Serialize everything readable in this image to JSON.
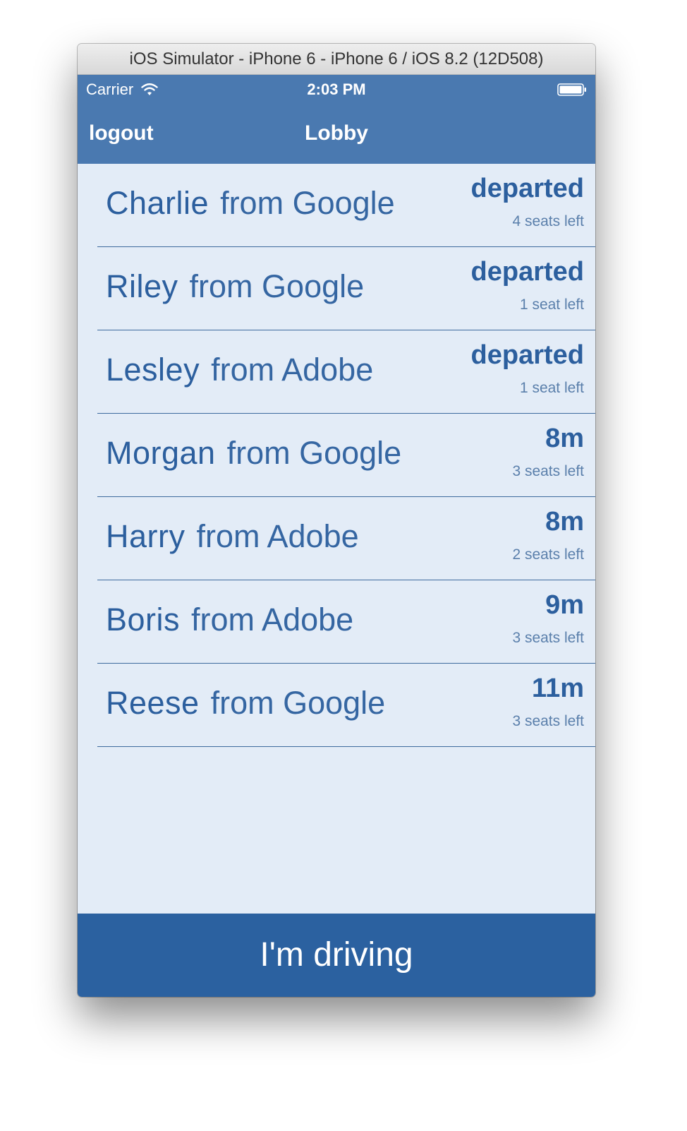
{
  "window": {
    "title": "iOS Simulator - iPhone 6 - iPhone 6 / iOS 8.2 (12D508)"
  },
  "statusbar": {
    "carrier": "Carrier",
    "time": "2:03 PM",
    "wifi_icon": "wifi-icon",
    "battery_icon": "battery-full-icon"
  },
  "navbar": {
    "left_button": "logout",
    "title": "Lobby"
  },
  "rides": [
    {
      "name": "Charlie",
      "company": "from Google",
      "status": "departed",
      "seats": "4 seats left"
    },
    {
      "name": "Riley",
      "company": "from Google",
      "status": "departed",
      "seats": "1 seat left"
    },
    {
      "name": "Lesley",
      "company": "from Adobe",
      "status": "departed",
      "seats": "1 seat left"
    },
    {
      "name": "Morgan",
      "company": "from Google",
      "status": "8m",
      "seats": "3 seats left"
    },
    {
      "name": "Harry",
      "company": "from Adobe",
      "status": "8m",
      "seats": "2 seats left"
    },
    {
      "name": "Boris",
      "company": "from Adobe",
      "status": "9m",
      "seats": "3 seats left"
    },
    {
      "name": "Reese",
      "company": "from Google",
      "status": "11m",
      "seats": "3 seats left"
    }
  ],
  "footer": {
    "button_label": "I'm driving"
  },
  "colors": {
    "nav_blue": "#4a79b0",
    "button_blue": "#2b61a0",
    "text_blue": "#2c5f9e",
    "list_background": "#e3ecf7"
  }
}
